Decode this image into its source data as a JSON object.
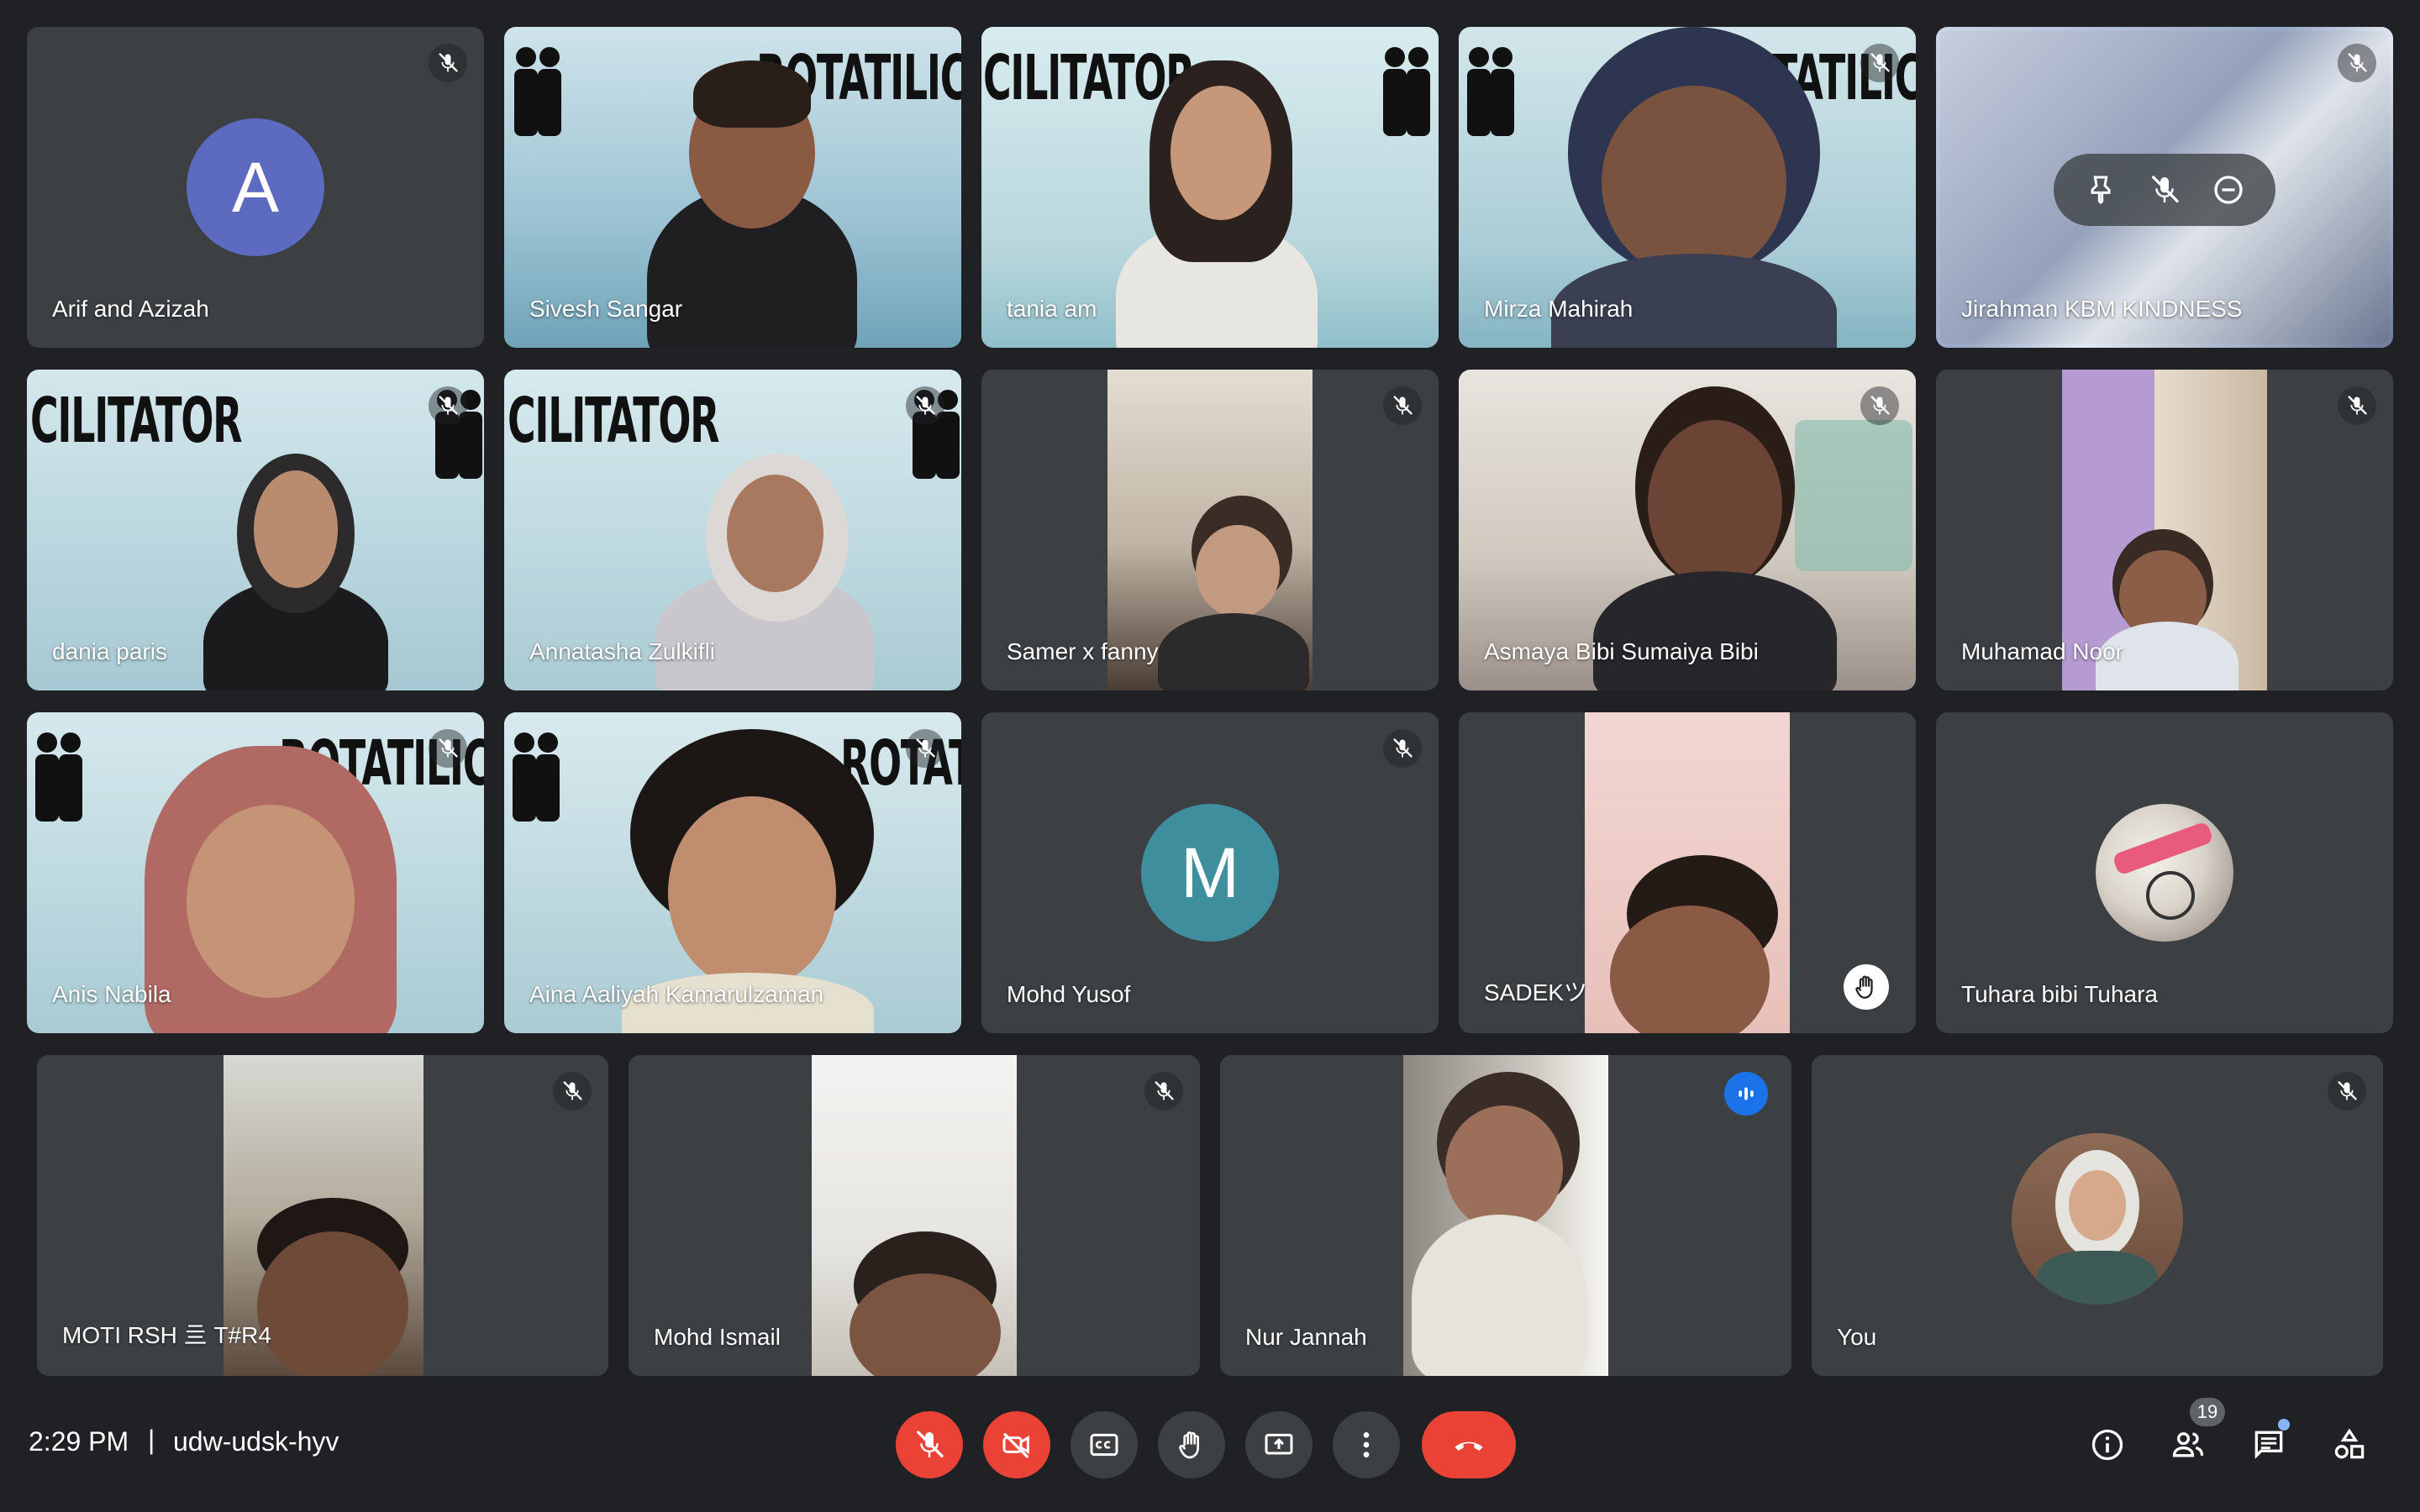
{
  "meeting": {
    "time": "2:29 PM",
    "separator": "|",
    "code": "udw-udsk-hyv"
  },
  "participants": [
    {
      "name": "Arif and Azizah",
      "avatar_letter": "A",
      "avatar_color": "#5c6bc0",
      "muted": true
    },
    {
      "name": "Sivesh Sangar",
      "muted": false
    },
    {
      "name": "tania am",
      "muted": false
    },
    {
      "name": "Mirza Mahirah",
      "muted": true
    },
    {
      "name": "Jirahman KBM KINDNESS",
      "muted": true,
      "highlighted": true
    },
    {
      "name": "dania paris",
      "muted": true
    },
    {
      "name": "Annatasha Zulkifli",
      "muted": true
    },
    {
      "name": "Samer x fanny",
      "muted": true
    },
    {
      "name": "Asmaya Bibi Sumaiya Bibi",
      "muted": true
    },
    {
      "name": "Muhamad Noor",
      "muted": true
    },
    {
      "name": "Anis Nabila",
      "muted": true
    },
    {
      "name": "Aina Aaliyah Kamarulzaman",
      "muted": true
    },
    {
      "name": "Mohd Yusof",
      "avatar_letter": "M",
      "avatar_color": "#3e8e9e",
      "muted": true
    },
    {
      "name": "SADEKツ",
      "muted": false,
      "hand_raised": true
    },
    {
      "name": "Tuhara bibi Tuhara",
      "muted": false
    },
    {
      "name": "MOTI RSH 亖 T#R4",
      "muted": true
    },
    {
      "name": "Mohd Ismail",
      "muted": true
    },
    {
      "name": "Nur Jannah",
      "muted": false,
      "speaking": true
    },
    {
      "name": "You",
      "muted": true
    }
  ],
  "backdrop": {
    "banner_text": "CILITATOR",
    "banner_text_mirrored": "ROTATILIC"
  },
  "controls": {
    "people_count": "19",
    "colors": {
      "end_call": "#ea4335",
      "muted_button": "#ea4335",
      "accent": "#8ab4f8"
    }
  }
}
